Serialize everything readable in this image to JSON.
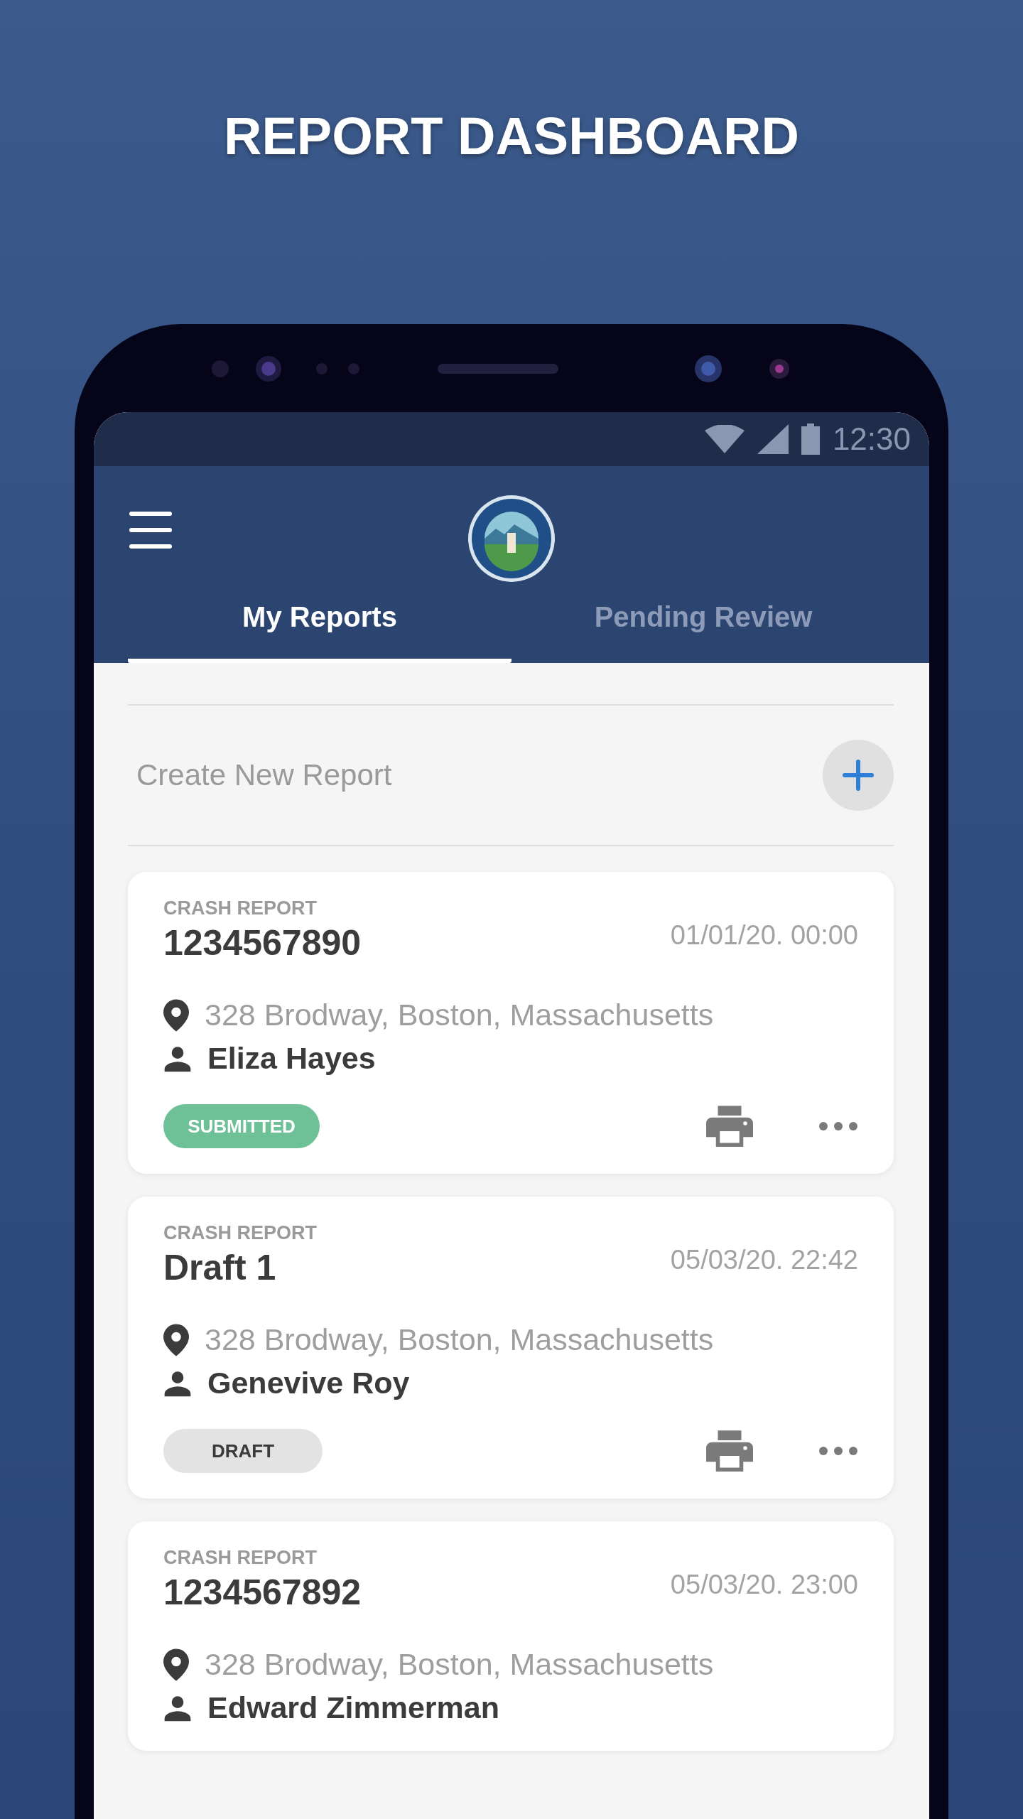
{
  "title": "REPORT DASHBOARD",
  "status_bar": {
    "time": "12:30"
  },
  "tabs": [
    {
      "label": "My Reports",
      "selected": true
    },
    {
      "label": "Pending Review",
      "selected": false
    }
  ],
  "create": {
    "label": "Create New Report"
  },
  "reports": [
    {
      "category": "CRASH REPORT",
      "number": "1234567890",
      "datetime": "01/01/20. 00:00",
      "address": "328 Brodway, Boston, Massachusetts",
      "person": "Eliza Hayes",
      "status": {
        "label": "SUBMITTED",
        "kind": "submitted"
      }
    },
    {
      "category": "CRASH REPORT",
      "number": "Draft 1",
      "datetime": "05/03/20. 22:42",
      "address": "328 Brodway, Boston, Massachusetts",
      "person": "Genevive Roy",
      "status": {
        "label": "DRAFT",
        "kind": "draft"
      }
    },
    {
      "category": "CRASH REPORT",
      "number": "1234567892",
      "datetime": "05/03/20. 23:00",
      "address": "328 Brodway, Boston, Massachusetts",
      "person": "Edward Zimmerman"
    }
  ]
}
